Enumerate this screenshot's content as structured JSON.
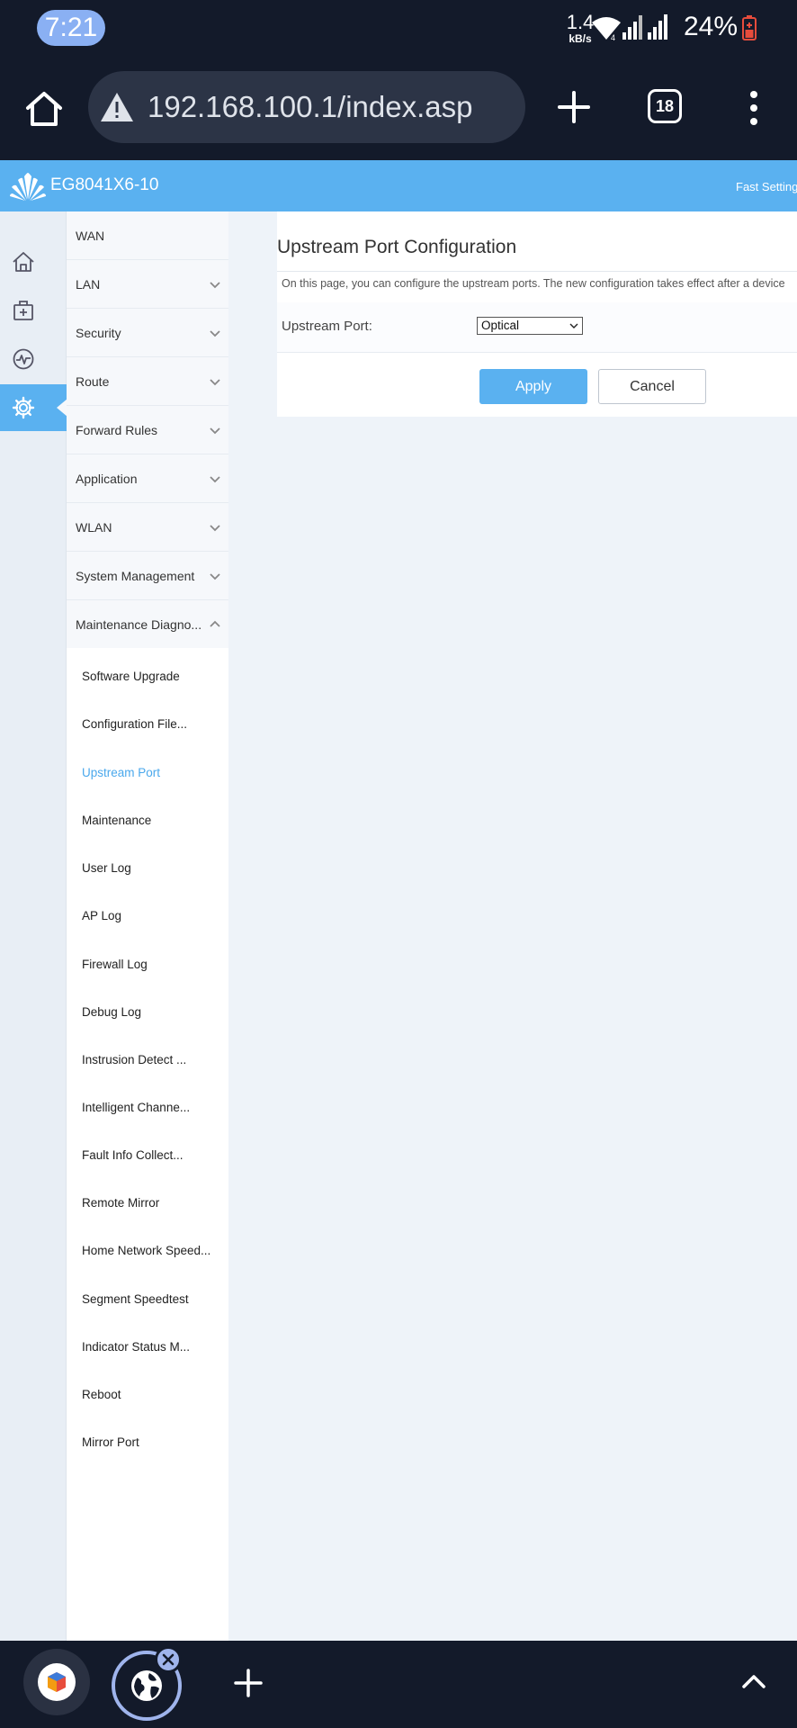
{
  "status_bar": {
    "time": "7:21",
    "net_speed_value": "1.4",
    "net_speed_unit": "kB/s",
    "battery_percent": "24%",
    "battery_color": "#e74c3c"
  },
  "browser": {
    "url": "192.168.100.1/index.asp",
    "tab_count": "18"
  },
  "router": {
    "model": "EG8041X6-10",
    "fast_setting": "Fast Setting",
    "brand_color": "#e8372c",
    "accent_color": "#5ab1f0"
  },
  "rail_icons": [
    {
      "icon": "home-icon"
    },
    {
      "icon": "medkit-icon"
    },
    {
      "icon": "pulse-icon"
    },
    {
      "icon": "gear-icon",
      "active": true
    }
  ],
  "menu": [
    {
      "label": "WAN"
    },
    {
      "label": "LAN"
    },
    {
      "label": "Security"
    },
    {
      "label": "Route"
    },
    {
      "label": "Forward Rules"
    },
    {
      "label": "Application"
    },
    {
      "label": "WLAN"
    },
    {
      "label": "System Management"
    },
    {
      "label": "Maintenance Diagno..."
    }
  ],
  "submenu": [
    {
      "label": "Software Upgrade"
    },
    {
      "label": "Configuration File..."
    },
    {
      "label": "Upstream Port",
      "active": true
    },
    {
      "label": "Maintenance"
    },
    {
      "label": "User Log"
    },
    {
      "label": "AP Log"
    },
    {
      "label": "Firewall Log"
    },
    {
      "label": "Debug Log"
    },
    {
      "label": "Instrusion Detect ..."
    },
    {
      "label": "Intelligent Channe..."
    },
    {
      "label": "Fault Info Collect..."
    },
    {
      "label": "Remote Mirror"
    },
    {
      "label": "Home Network Speed..."
    },
    {
      "label": "Segment Speedtest"
    },
    {
      "label": "Indicator Status M..."
    },
    {
      "label": "Reboot"
    },
    {
      "label": "Mirror Port"
    }
  ],
  "page": {
    "title": "Upstream Port Configuration",
    "description": "On this page, you can configure the upstream ports. The new configuration takes effect after a device",
    "upstream_port_label": "Upstream Port:",
    "upstream_port_value": "Optical",
    "apply_label": "Apply",
    "cancel_label": "Cancel"
  }
}
